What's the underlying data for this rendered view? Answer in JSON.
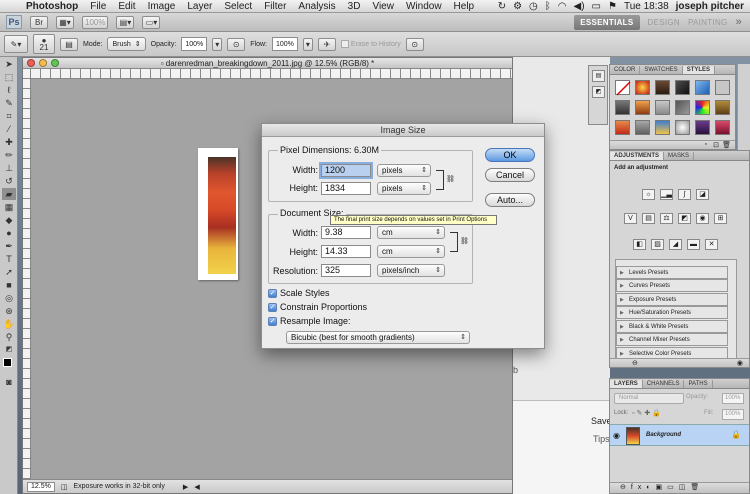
{
  "menubar": {
    "apple": "",
    "app": "Photoshop",
    "items": [
      "File",
      "Edit",
      "Image",
      "Layer",
      "Select",
      "Filter",
      "Analysis",
      "3D",
      "View",
      "Window",
      "Help"
    ],
    "clock": "Tue 18:38",
    "user": "joseph pitcher"
  },
  "appbar": {
    "logo": "Ps",
    "zoom": "100%",
    "workspaces": [
      "ESSENTIALS",
      "DESIGN",
      "PAINTING"
    ],
    "more": "»"
  },
  "options": {
    "brush_size": "21",
    "mode_label": "Mode:",
    "mode_value": "Brush",
    "opacity_label": "Opacity:",
    "opacity_value": "100%",
    "flow_label": "Flow:",
    "flow_value": "100%",
    "erase_history": "Erase to History"
  },
  "document": {
    "title": "darenredman_breakingdown_2011.jpg @ 12.5% (RGB/8) *",
    "zoom": "12.5%",
    "status": "Exposure works in 32-bit only"
  },
  "swatches_panel": {
    "tabs": [
      "COLOR",
      "SWATCHES",
      "STYLES"
    ],
    "active_tab": "STYLES"
  },
  "adjustments_panel": {
    "tabs": [
      "ADJUSTMENTS",
      "MASKS"
    ],
    "active_tab": "ADJUSTMENTS",
    "heading": "Add an adjustment",
    "presets": [
      "Levels Presets",
      "Curves Presets",
      "Exposure Presets",
      "Hue/Saturation Presets",
      "Black & White Presets",
      "Channel Mixer Presets",
      "Selective Color Presets"
    ]
  },
  "layers_panel": {
    "tabs": [
      "LAYERS",
      "CHANNELS",
      "PATHS"
    ],
    "active_tab": "LAYERS",
    "blend_mode": "Normal",
    "opacity_label": "Opacity:",
    "opacity_value": "100%",
    "lock_label": "Lock:",
    "fill_label": "Fill:",
    "fill_value": "100%",
    "layer_name": "Background"
  },
  "background_window": {
    "save": "Save",
    "tips": "Tips"
  },
  "dialog": {
    "title": "Image Size",
    "pixel_dimensions": "Pixel Dimensions:  6.30M",
    "width_label": "Width:",
    "width_value": "1200",
    "width_unit": "pixels",
    "height_label": "Height:",
    "height_value": "1834",
    "height_unit": "pixels",
    "document_size": "Document Size:",
    "doc_width_label": "Width:",
    "doc_width_value": "9.38",
    "doc_width_unit": "cm",
    "doc_height_label": "Height:",
    "doc_height_value": "14.33",
    "doc_height_unit": "cm",
    "resolution_label": "Resolution:",
    "resolution_value": "325",
    "resolution_unit": "pixels/inch",
    "scale_styles": "Scale Styles",
    "constrain": "Constrain Proportions",
    "resample": "Resample Image:",
    "resample_method": "Bicubic (best for smooth gradients)",
    "ok": "OK",
    "cancel": "Cancel",
    "auto": "Auto...",
    "tooltip": "The final print size depends on values set in Print Options"
  },
  "colors": {
    "accent": "#5d9ae2",
    "tooltip": "#ffffc6",
    "layer_selected": "#b8d3f3"
  }
}
